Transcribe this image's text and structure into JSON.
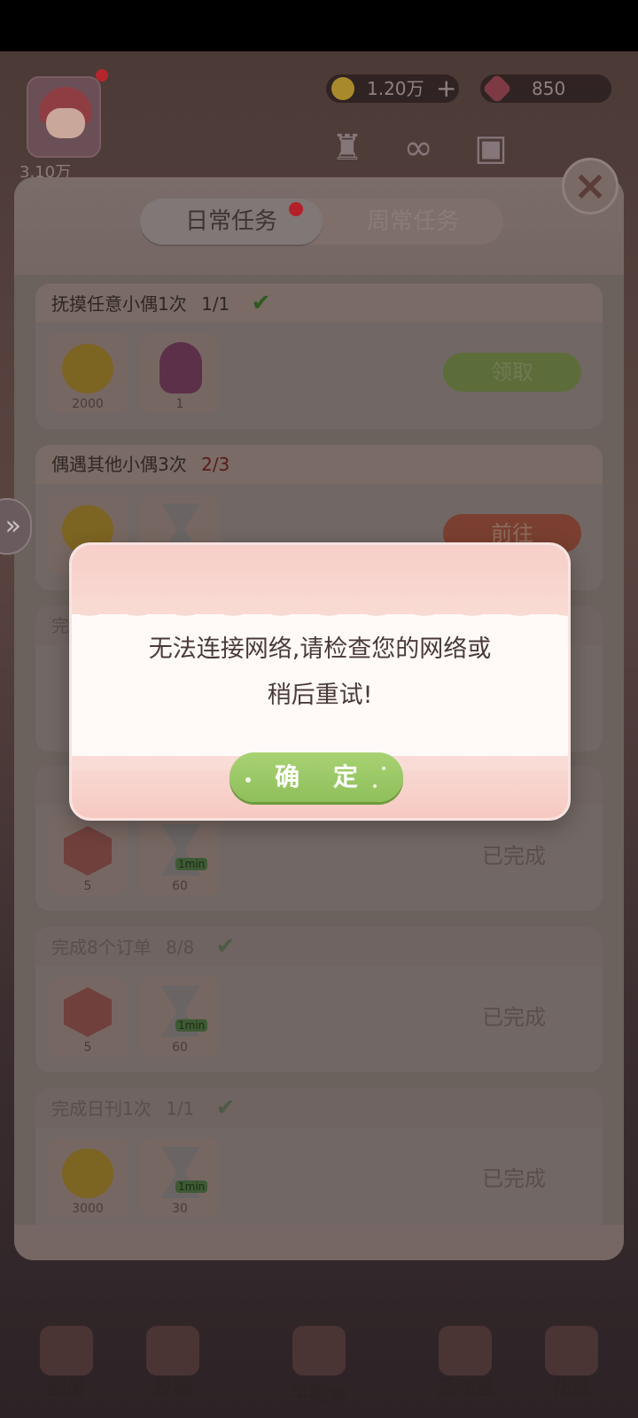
{
  "hud": {
    "level": "3.10万",
    "coins": "1.20万",
    "coins_plus": "+",
    "gems": "850"
  },
  "tabs": {
    "daily": "日常任务",
    "weekly": "周常任务"
  },
  "tasks": [
    {
      "title": "抚摸任意小偶1次",
      "progress": "1/1",
      "rewards": [
        {
          "icon": "coin-icon",
          "qty": "2000"
        },
        {
          "icon": "bag-icon",
          "qty": "1"
        }
      ],
      "action": "领取"
    },
    {
      "title": "偶遇其他小偶3次",
      "progress": "2/3",
      "action": "前往"
    },
    {
      "title": "完",
      "rewards": [
        {
          "icon": "hexagon-gem-icon",
          "qty": "5"
        },
        {
          "icon": "hourglass-icon",
          "badge": "1min",
          "qty": "60"
        }
      ],
      "status": "已完成"
    },
    {
      "title": "完成8个订单",
      "progress": "8/8",
      "rewards": [
        {
          "icon": "hexagon-gem-icon",
          "qty": "5"
        },
        {
          "icon": "hourglass-icon",
          "badge": "1min",
          "qty": "60"
        }
      ],
      "status": "已完成"
    },
    {
      "title": "完成日刊1次",
      "progress": "1/1",
      "rewards": [
        {
          "icon": "coin-icon",
          "qty": "3000"
        },
        {
          "icon": "hourglass-icon",
          "badge": "1min",
          "qty": "30"
        }
      ],
      "status": "已完成"
    }
  ],
  "check_mark": "✔",
  "bottom_nav": [
    "图册",
    "投稿",
    "手账本",
    "活动室",
    "花盆"
  ],
  "dialog": {
    "message_line1": "无法连接网络,请检查您的网络或",
    "message_line2": "稍后重试!",
    "confirm": "确 定"
  },
  "colors": {
    "confirm_green": "#9ccb67",
    "dialog_pink": "#f8d4cd",
    "red_dot": "#d7262f"
  }
}
